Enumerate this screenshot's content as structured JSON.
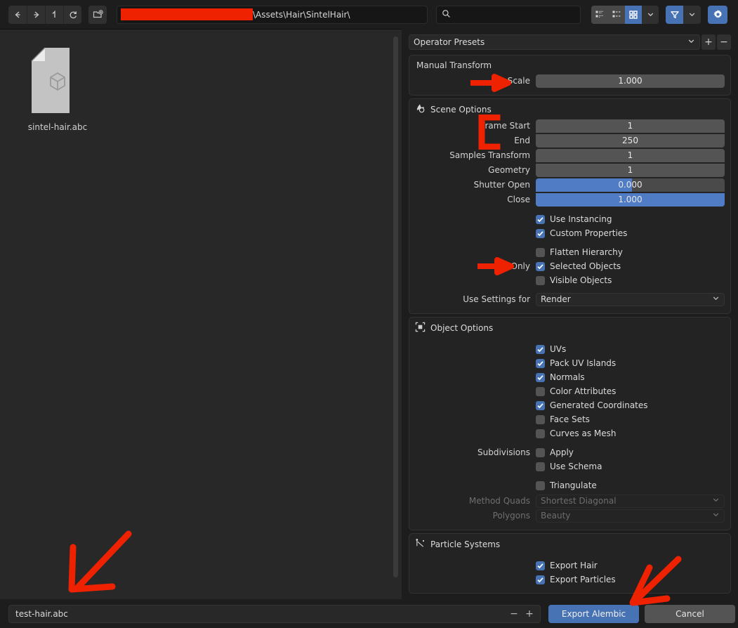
{
  "toolbar": {
    "back_icon": "arrow-left-icon",
    "forward_icon": "arrow-right-icon",
    "up_icon": "arrow-up-icon",
    "refresh_icon": "refresh-icon",
    "new_folder_icon": "new-folder-icon",
    "path_value": "\\Assets\\Hair\\SintelHair\\",
    "path_redacted": true,
    "search_placeholder": "",
    "search_value": "",
    "view_modes": [
      {
        "name": "list-view",
        "active": false
      },
      {
        "name": "detail-view",
        "active": false
      },
      {
        "name": "thumbnail-view",
        "active": true
      }
    ],
    "filter_active": true,
    "settings_active": true,
    "accent": "#4772b3",
    "redact_color": "#ee2200"
  },
  "browser": {
    "files": [
      {
        "name": "sintel-hair.abc",
        "icon": "alembic-file-icon"
      }
    ]
  },
  "properties": {
    "preset": {
      "label": "Operator Presets",
      "add_label": "+",
      "remove_label": "−"
    },
    "manual_transform": {
      "section_label": "Manual Transform",
      "scale_label": "Scale",
      "scale_value": "1.000"
    },
    "scene_options": {
      "title": "Scene Options",
      "icon": "scene-physics-icon",
      "fields": [
        {
          "label": "Frame Start",
          "value": "1",
          "type": "number"
        },
        {
          "label": "End",
          "value": "250",
          "type": "number"
        },
        {
          "label": "Samples Transform",
          "value": "1",
          "type": "number"
        },
        {
          "label": "Geometry",
          "value": "1",
          "type": "number"
        },
        {
          "label": "Shutter Open",
          "value": "0.000",
          "type": "slider",
          "fill_pct": 51
        },
        {
          "label": "Close",
          "value": "1.000",
          "type": "slider",
          "fill_pct": 100
        }
      ],
      "checkboxes": [
        {
          "label": "Use Instancing",
          "checked": true,
          "prefix": ""
        },
        {
          "label": "Custom Properties",
          "checked": true,
          "prefix": ""
        },
        {
          "label": "Flatten Hierarchy",
          "checked": false,
          "prefix": ""
        },
        {
          "label": "Selected Objects",
          "checked": true,
          "prefix": "Only"
        },
        {
          "label": "Visible Objects",
          "checked": false,
          "prefix": ""
        }
      ],
      "use_settings_label": "Use Settings for",
      "use_settings_value": "Render"
    },
    "object_options": {
      "title": "Object Options",
      "icon": "select-box-icon",
      "checkboxes": [
        {
          "label": "UVs",
          "checked": true,
          "prefix": ""
        },
        {
          "label": "Pack UV Islands",
          "checked": true,
          "prefix": ""
        },
        {
          "label": "Normals",
          "checked": true,
          "prefix": ""
        },
        {
          "label": "Color Attributes",
          "checked": false,
          "prefix": ""
        },
        {
          "label": "Generated Coordinates",
          "checked": true,
          "prefix": ""
        },
        {
          "label": "Face Sets",
          "checked": false,
          "prefix": ""
        },
        {
          "label": "Curves as Mesh",
          "checked": false,
          "prefix": ""
        }
      ],
      "subdiv": [
        {
          "label": "Apply",
          "checked": false,
          "prefix": "Subdivisions"
        },
        {
          "label": "Use Schema",
          "checked": false,
          "prefix": ""
        }
      ],
      "triangulate": {
        "label": "Triangulate",
        "checked": false,
        "prefix": ""
      },
      "method_quads_label": "Method Quads",
      "method_quads_value": "Shortest Diagonal",
      "polygons_label": "Polygons",
      "polygons_value": "Beauty"
    },
    "particle_systems": {
      "title": "Particle Systems",
      "icon": "particles-icon",
      "checkboxes": [
        {
          "label": "Export Hair",
          "checked": true,
          "prefix": ""
        },
        {
          "label": "Export Particles",
          "checked": true,
          "prefix": ""
        }
      ]
    }
  },
  "footer": {
    "filename_value": "test-hair.abc",
    "decrement_label": "−",
    "increment_label": "+",
    "confirm_label": "Export Alembic",
    "cancel_label": "Cancel"
  },
  "annotations": {
    "color": "#ee2200",
    "items": [
      {
        "name": "arrow-to-scale",
        "shape": "right-arrow"
      },
      {
        "name": "bracket-frame-range",
        "shape": "bracket"
      },
      {
        "name": "arrow-to-selected-objects",
        "shape": "right-arrow"
      },
      {
        "name": "arrow-to-filename",
        "shape": "down-left-arrow"
      },
      {
        "name": "arrow-to-export-button",
        "shape": "down-left-arrow"
      }
    ]
  }
}
